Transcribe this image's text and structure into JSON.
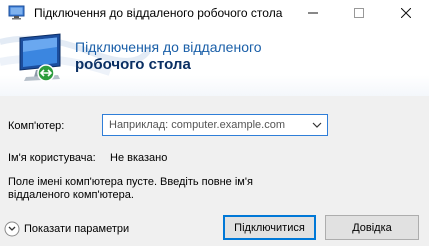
{
  "window": {
    "title": "Підключення до віддаленого робочого стола",
    "controls": {
      "minimize": "—",
      "maximize": "☐",
      "close": "✕"
    }
  },
  "banner": {
    "line1": "Підключення до віддаленого",
    "line2": "робочого стола",
    "icon": "remote-desktop-monitor-icon"
  },
  "form": {
    "computer_label": "Комп'ютер:",
    "computer_placeholder": "Наприклад: computer.example.com",
    "user_label": "Ім'я користувача:",
    "user_value": "Не вказано",
    "hint": "Поле імені комп'ютера пусте. Введіть повне ім'я віддаленого комп'ютера."
  },
  "footer": {
    "show_params": "Показати параметри",
    "connect": "Підключитися",
    "help": "Довідка"
  },
  "colors": {
    "accent": "#0078d7",
    "banner_title": "#1a5fa8",
    "banner_title_bold": "#0a2f63",
    "background": "#f0f0f0"
  }
}
